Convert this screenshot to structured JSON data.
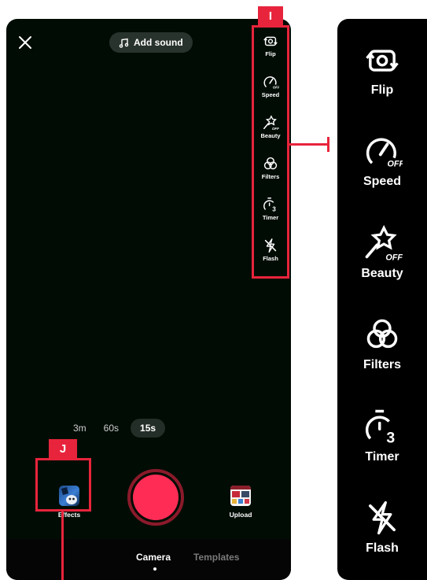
{
  "header": {
    "add_sound_label": "Add sound"
  },
  "tools": [
    {
      "label": "Flip",
      "icon": "flip-icon"
    },
    {
      "label": "Speed",
      "icon": "speed-icon"
    },
    {
      "label": "Beauty",
      "icon": "beauty-icon"
    },
    {
      "label": "Filters",
      "icon": "filters-icon"
    },
    {
      "label": "Timer",
      "icon": "timer-icon"
    },
    {
      "label": "Flash",
      "icon": "flash-icon"
    }
  ],
  "callouts": {
    "i_tag": "I",
    "j_tag": "J"
  },
  "durations": {
    "items": [
      "3m",
      "60s",
      "15s"
    ],
    "selected": "15s"
  },
  "bottom_controls": {
    "effects_label": "Effects",
    "upload_label": "Upload"
  },
  "tabs": {
    "camera": "Camera",
    "templates": "Templates",
    "active": "Camera"
  },
  "colors": {
    "highlight": "#e8243c",
    "record": "#ff2c55",
    "viewfinder": "#010c05"
  }
}
